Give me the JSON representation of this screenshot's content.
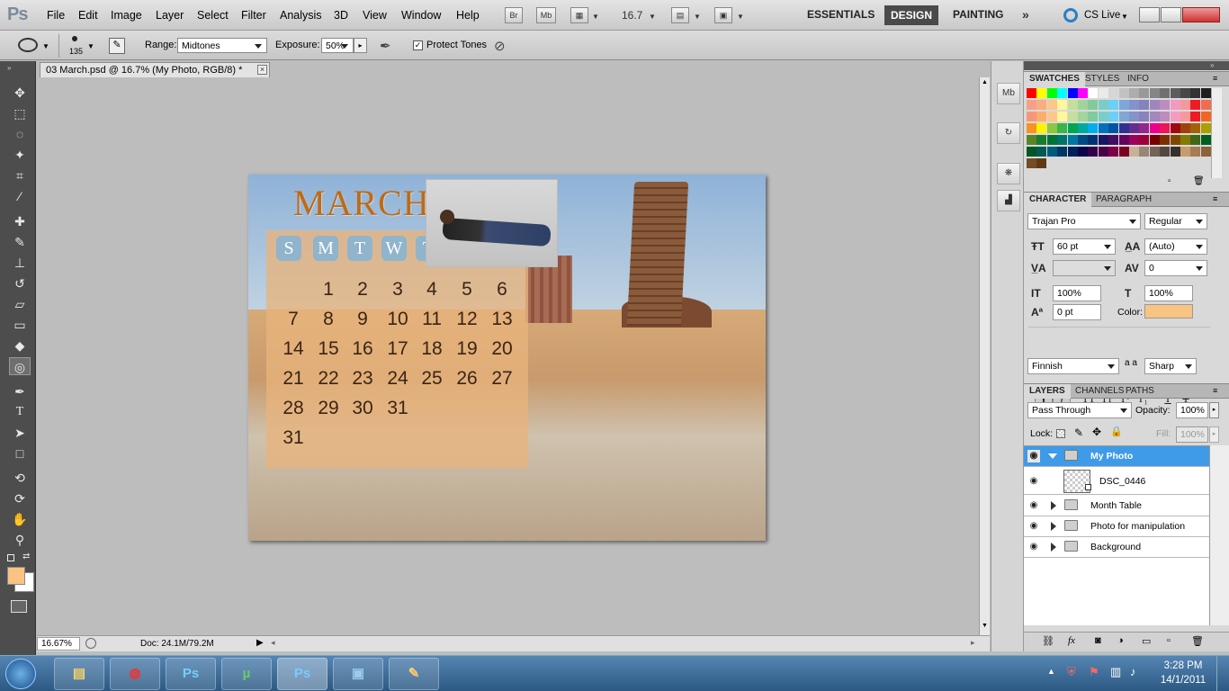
{
  "app": {
    "logo": "Ps"
  },
  "menu": [
    "File",
    "Edit",
    "Image",
    "Layer",
    "Select",
    "Filter",
    "Analysis",
    "3D",
    "View",
    "Window",
    "Help"
  ],
  "appbar": {
    "br": "Br",
    "mb": "Mb",
    "zoom": "16.7",
    "workspaces": [
      "ESSENTIALS",
      "DESIGN",
      "PAINTING"
    ],
    "cs_live": "CS Live"
  },
  "options": {
    "brush_size": "135",
    "range_label": "Range:",
    "range_value": "Midtones",
    "exposure_label": "Exposure:",
    "exposure_value": "50%",
    "protect_tones": "Protect Tones"
  },
  "document": {
    "tab_title": "03 March.psd @ 16.7% (My Photo, RGB/8) *",
    "zoom": "16.67%",
    "doc_info": "Doc: 24.1M/79.2M"
  },
  "calendar": {
    "month": "MARCH",
    "weekdays": [
      "S",
      "M",
      "T",
      "W",
      "T"
    ],
    "rows": [
      [
        "",
        "",
        "1",
        "2",
        "3",
        "4",
        "5",
        "6"
      ],
      [
        "7",
        "8",
        "9",
        "10",
        "11",
        "12",
        "13"
      ],
      [
        "14",
        "15",
        "16",
        "17",
        "18",
        "19",
        "20"
      ],
      [
        "21",
        "22",
        "23",
        "24",
        "25",
        "26",
        "27"
      ],
      [
        "28",
        "29",
        "30",
        "31"
      ],
      [
        "31"
      ]
    ]
  },
  "swatch_panel": {
    "tabs": [
      "SWATCHES",
      "STYLES",
      "INFO"
    ]
  },
  "character": {
    "tabs": [
      "CHARACTER",
      "PARAGRAPH"
    ],
    "font_family": "Trajan Pro",
    "font_style": "Regular",
    "size": "60 pt",
    "leading": "(Auto)",
    "kerning": "",
    "tracking": "0",
    "vscale": "100%",
    "hscale": "100%",
    "baseline": "0 pt",
    "color_label": "Color:",
    "language": "Finnish",
    "aa_label": "a a",
    "antialias": "Sharp",
    "text_color": "#f9c383"
  },
  "layers": {
    "tabs": [
      "LAYERS",
      "CHANNELS",
      "PATHS"
    ],
    "blend_mode": "Pass Through",
    "opacity_label": "Opacity:",
    "opacity": "100%",
    "lock_label": "Lock:",
    "fill_label": "Fill:",
    "fill": "100%",
    "items": [
      {
        "name": "My Photo",
        "type": "group",
        "expanded": true,
        "selected": true
      },
      {
        "name": "DSC_0446",
        "type": "smart-object",
        "indent": true
      },
      {
        "name": "Month Table",
        "type": "group"
      },
      {
        "name": "Photo for manipulation",
        "type": "group"
      },
      {
        "name": "Background",
        "type": "group"
      }
    ]
  },
  "taskbar": {
    "time": "3:28 PM",
    "date": "14/1/2011"
  },
  "colors": {
    "accent_select": "#3f9ae8",
    "foreground": "#f9c383",
    "background": "#ffffff"
  }
}
